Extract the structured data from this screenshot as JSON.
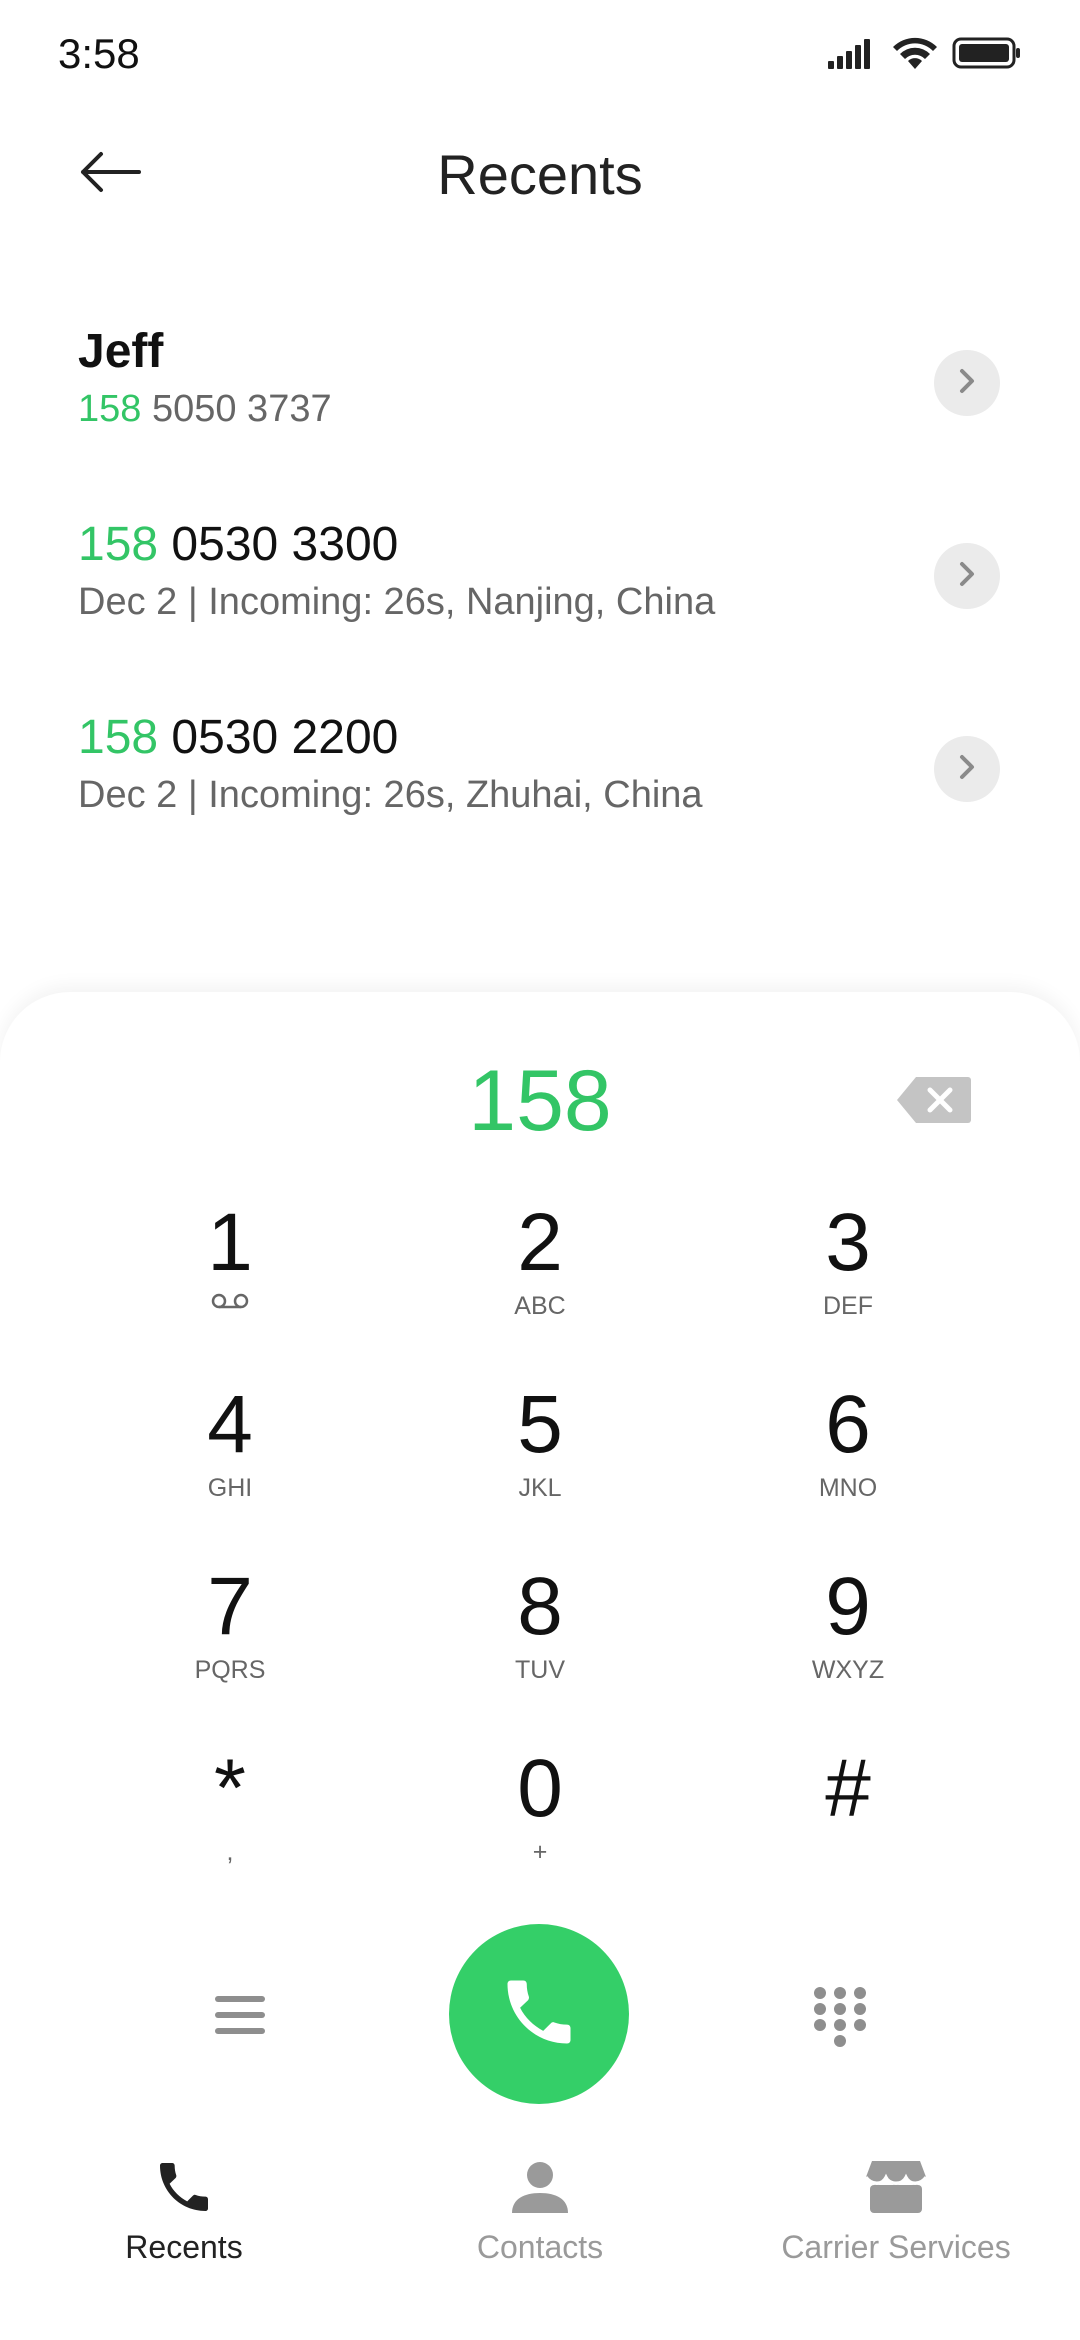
{
  "status_bar": {
    "time": "3:58"
  },
  "header": {
    "title": "Recents"
  },
  "recents": [
    {
      "primary_prefix": "",
      "primary_rest": "Jeff",
      "secondary_match": "158",
      "secondary_rest": " 5050 3737"
    },
    {
      "primary_prefix": "158",
      "primary_rest": " 0530 3300",
      "secondary_match": "",
      "secondary_rest": "Dec 2 | Incoming: 26s, Nanjing, China"
    },
    {
      "primary_prefix": "158",
      "primary_rest": " 0530 2200",
      "secondary_match": "",
      "secondary_rest": "Dec 2 | Incoming: 26s, Zhuhai, China"
    }
  ],
  "dialer": {
    "number": "158",
    "keys": [
      {
        "digit": "1",
        "letters": ""
      },
      {
        "digit": "2",
        "letters": "ABC"
      },
      {
        "digit": "3",
        "letters": "DEF"
      },
      {
        "digit": "4",
        "letters": "GHI"
      },
      {
        "digit": "5",
        "letters": "JKL"
      },
      {
        "digit": "6",
        "letters": "MNO"
      },
      {
        "digit": "7",
        "letters": "PQRS"
      },
      {
        "digit": "8",
        "letters": "TUV"
      },
      {
        "digit": "9",
        "letters": "WXYZ"
      },
      {
        "digit": "*",
        "letters": ","
      },
      {
        "digit": "0",
        "letters": "+"
      },
      {
        "digit": "#",
        "letters": ""
      }
    ]
  },
  "bottom_nav": {
    "items": [
      {
        "label": "Recents",
        "icon": "phone-icon",
        "active": true
      },
      {
        "label": "Contacts",
        "icon": "person-icon",
        "active": false
      },
      {
        "label": "Carrier Services",
        "icon": "store-icon",
        "active": false
      }
    ]
  },
  "colors": {
    "accent_green": "#33c566",
    "call_button": "#34cf68",
    "secondary_text": "#666666",
    "inactive_nav": "#9a9a9a"
  }
}
